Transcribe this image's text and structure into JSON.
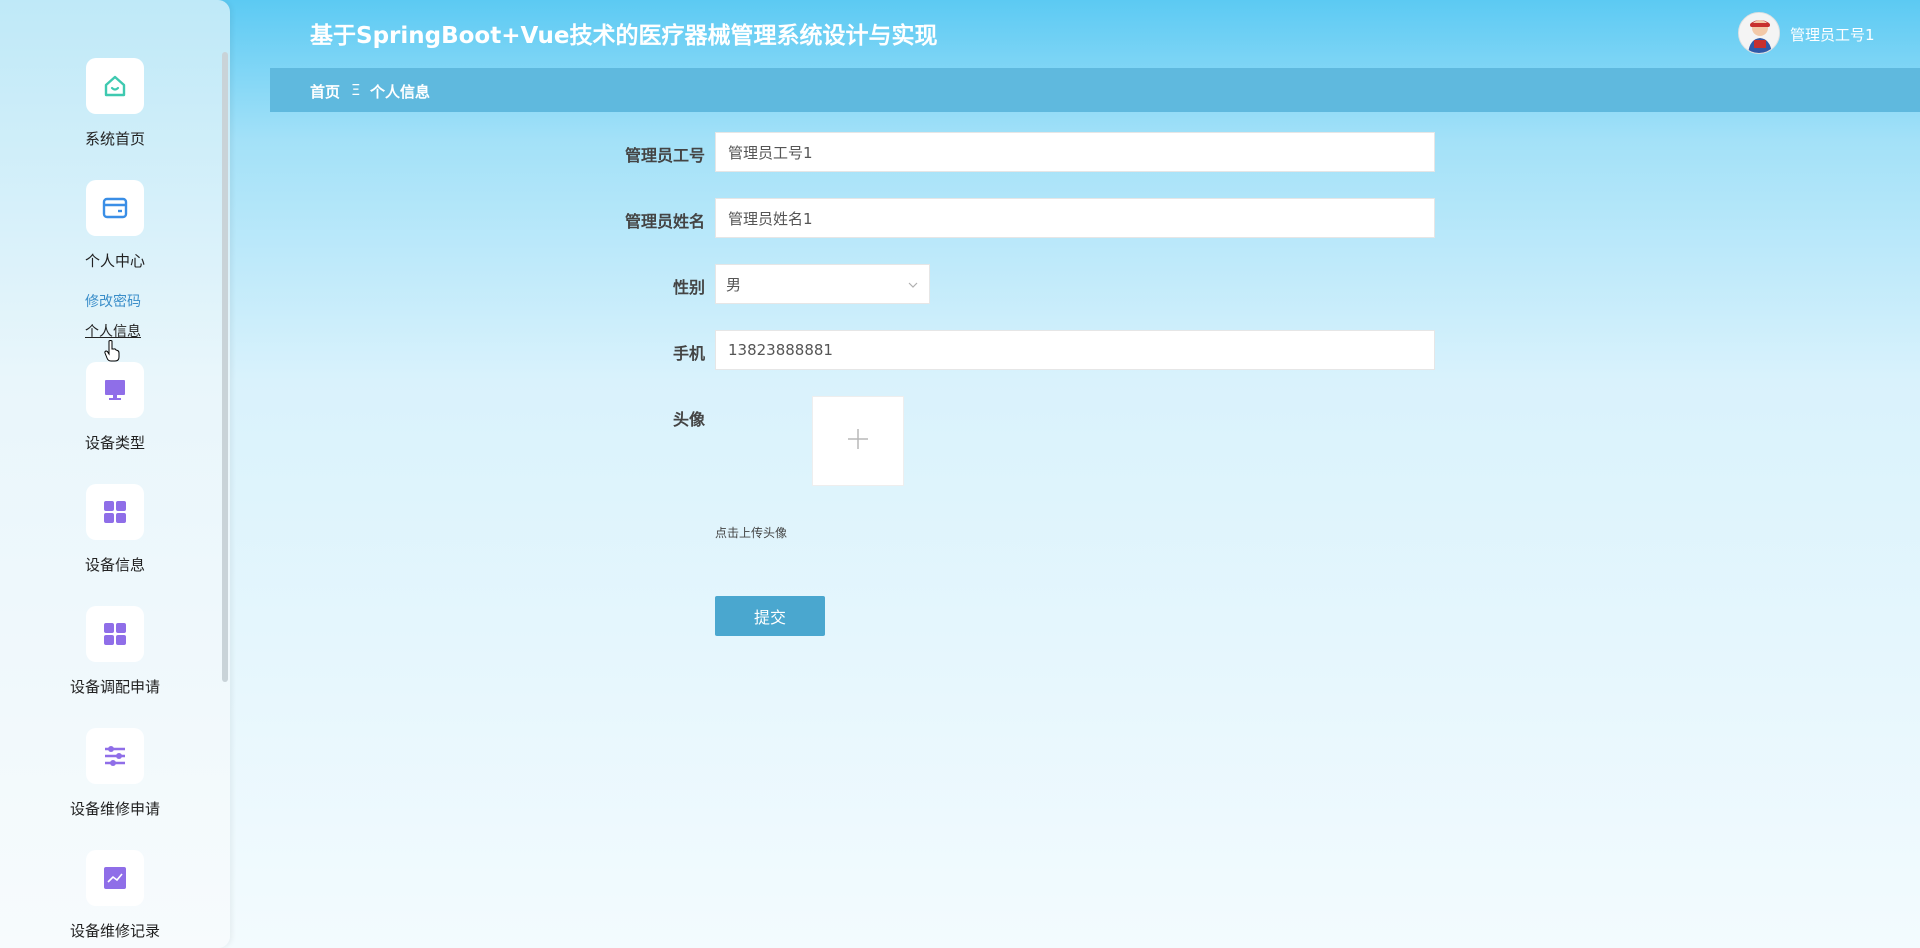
{
  "app": {
    "title": "基于SpringBoot+Vue技术的医疗器械管理系统设计与实现",
    "username": "管理员工号1"
  },
  "breadcrumb": {
    "home": "首页",
    "separator": "Ξ",
    "current": "个人信息"
  },
  "sidebar": {
    "items": [
      {
        "label": "系统首页",
        "icon": "home-icon",
        "color": "#3ec9b0"
      },
      {
        "label": "个人中心",
        "icon": "card-icon",
        "color": "#3a8ee6"
      },
      {
        "label": "设备类型",
        "icon": "monitor-icon",
        "color": "#8f6ee8"
      },
      {
        "label": "设备信息",
        "icon": "grid-icon",
        "color": "#8f6ee8"
      },
      {
        "label": "设备调配申请",
        "icon": "grid-icon",
        "color": "#8f6ee8"
      },
      {
        "label": "设备维修申请",
        "icon": "sliders-icon",
        "color": "#8f6ee8"
      },
      {
        "label": "设备维修记录",
        "icon": "chart-icon",
        "color": "#8f6ee8"
      }
    ],
    "sub_items": [
      {
        "label": "修改密码"
      },
      {
        "label": "个人信息"
      }
    ]
  },
  "form": {
    "fields": {
      "id": {
        "label": "管理员工号",
        "value": "管理员工号1"
      },
      "name": {
        "label": "管理员姓名",
        "value": "管理员姓名1"
      },
      "gender": {
        "label": "性别",
        "value": "男"
      },
      "phone": {
        "label": "手机",
        "value": "13823888881"
      },
      "avatar": {
        "label": "头像"
      }
    },
    "upload_tip": "点击上传头像",
    "submit_label": "提交"
  }
}
